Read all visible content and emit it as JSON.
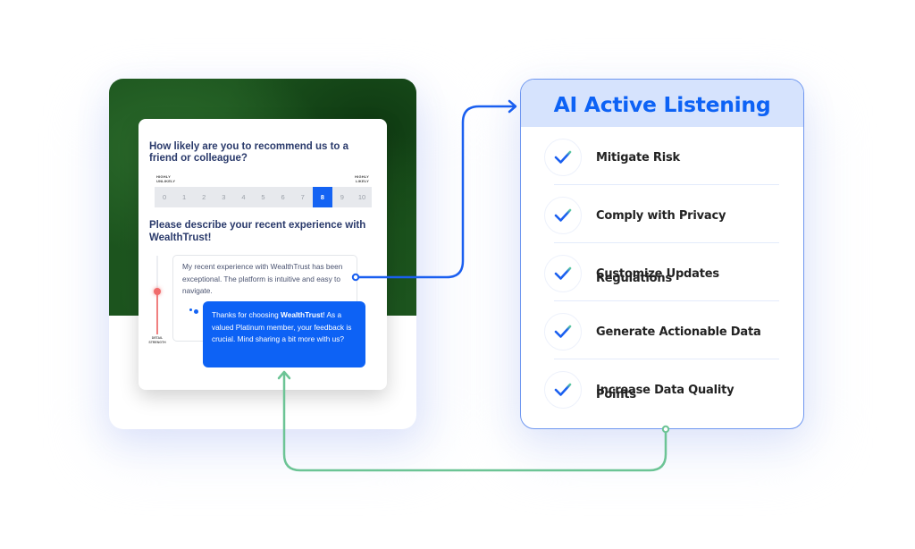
{
  "survey": {
    "question1": "How likely are you to recommend us to a friend or colleague?",
    "scale_low_label": "HIGHLY UNLIKELY",
    "scale_high_label": "HIGHLY LIKELY",
    "scale_options": [
      "0",
      "1",
      "2",
      "3",
      "4",
      "5",
      "6",
      "7",
      "8",
      "9",
      "10"
    ],
    "selected_score": "8",
    "question2": "Please describe your recent experience  with WealthTrust!",
    "response_text": "My recent experience with WealthTrust has been exceptional. The platform is intuitive and easy to navigate.",
    "detail_strength_label": "DETAIL STRENGTH",
    "detail_strength_level": 0.55,
    "ai_followup": {
      "prefix": "Thanks for choosing ",
      "brand": "WealthTrust",
      "suffix": "! As a valued Platinum member, your feedback is crucial. Mind sharing a bit more with us?"
    }
  },
  "ai_panel": {
    "title": "AI Active Listening",
    "items": [
      {
        "label": "Mitigate Risk",
        "icon": "check-icon"
      },
      {
        "label": "Comply with Privacy Regulations",
        "icon": "check-icon"
      },
      {
        "label": "Customize Updates",
        "icon": "check-icon"
      },
      {
        "label": "Generate Actionable Data Points",
        "icon": "check-icon"
      },
      {
        "label": "Increase Data Quality",
        "icon": "check-icon"
      }
    ]
  },
  "colors": {
    "primary_blue": "#0d62f5",
    "connector_blue": "#1a5ff0",
    "connector_green": "#6cc495",
    "header_bg": "#d6e3fd",
    "green_bg": "#1c541e",
    "slider_red": "#f06c6c"
  }
}
